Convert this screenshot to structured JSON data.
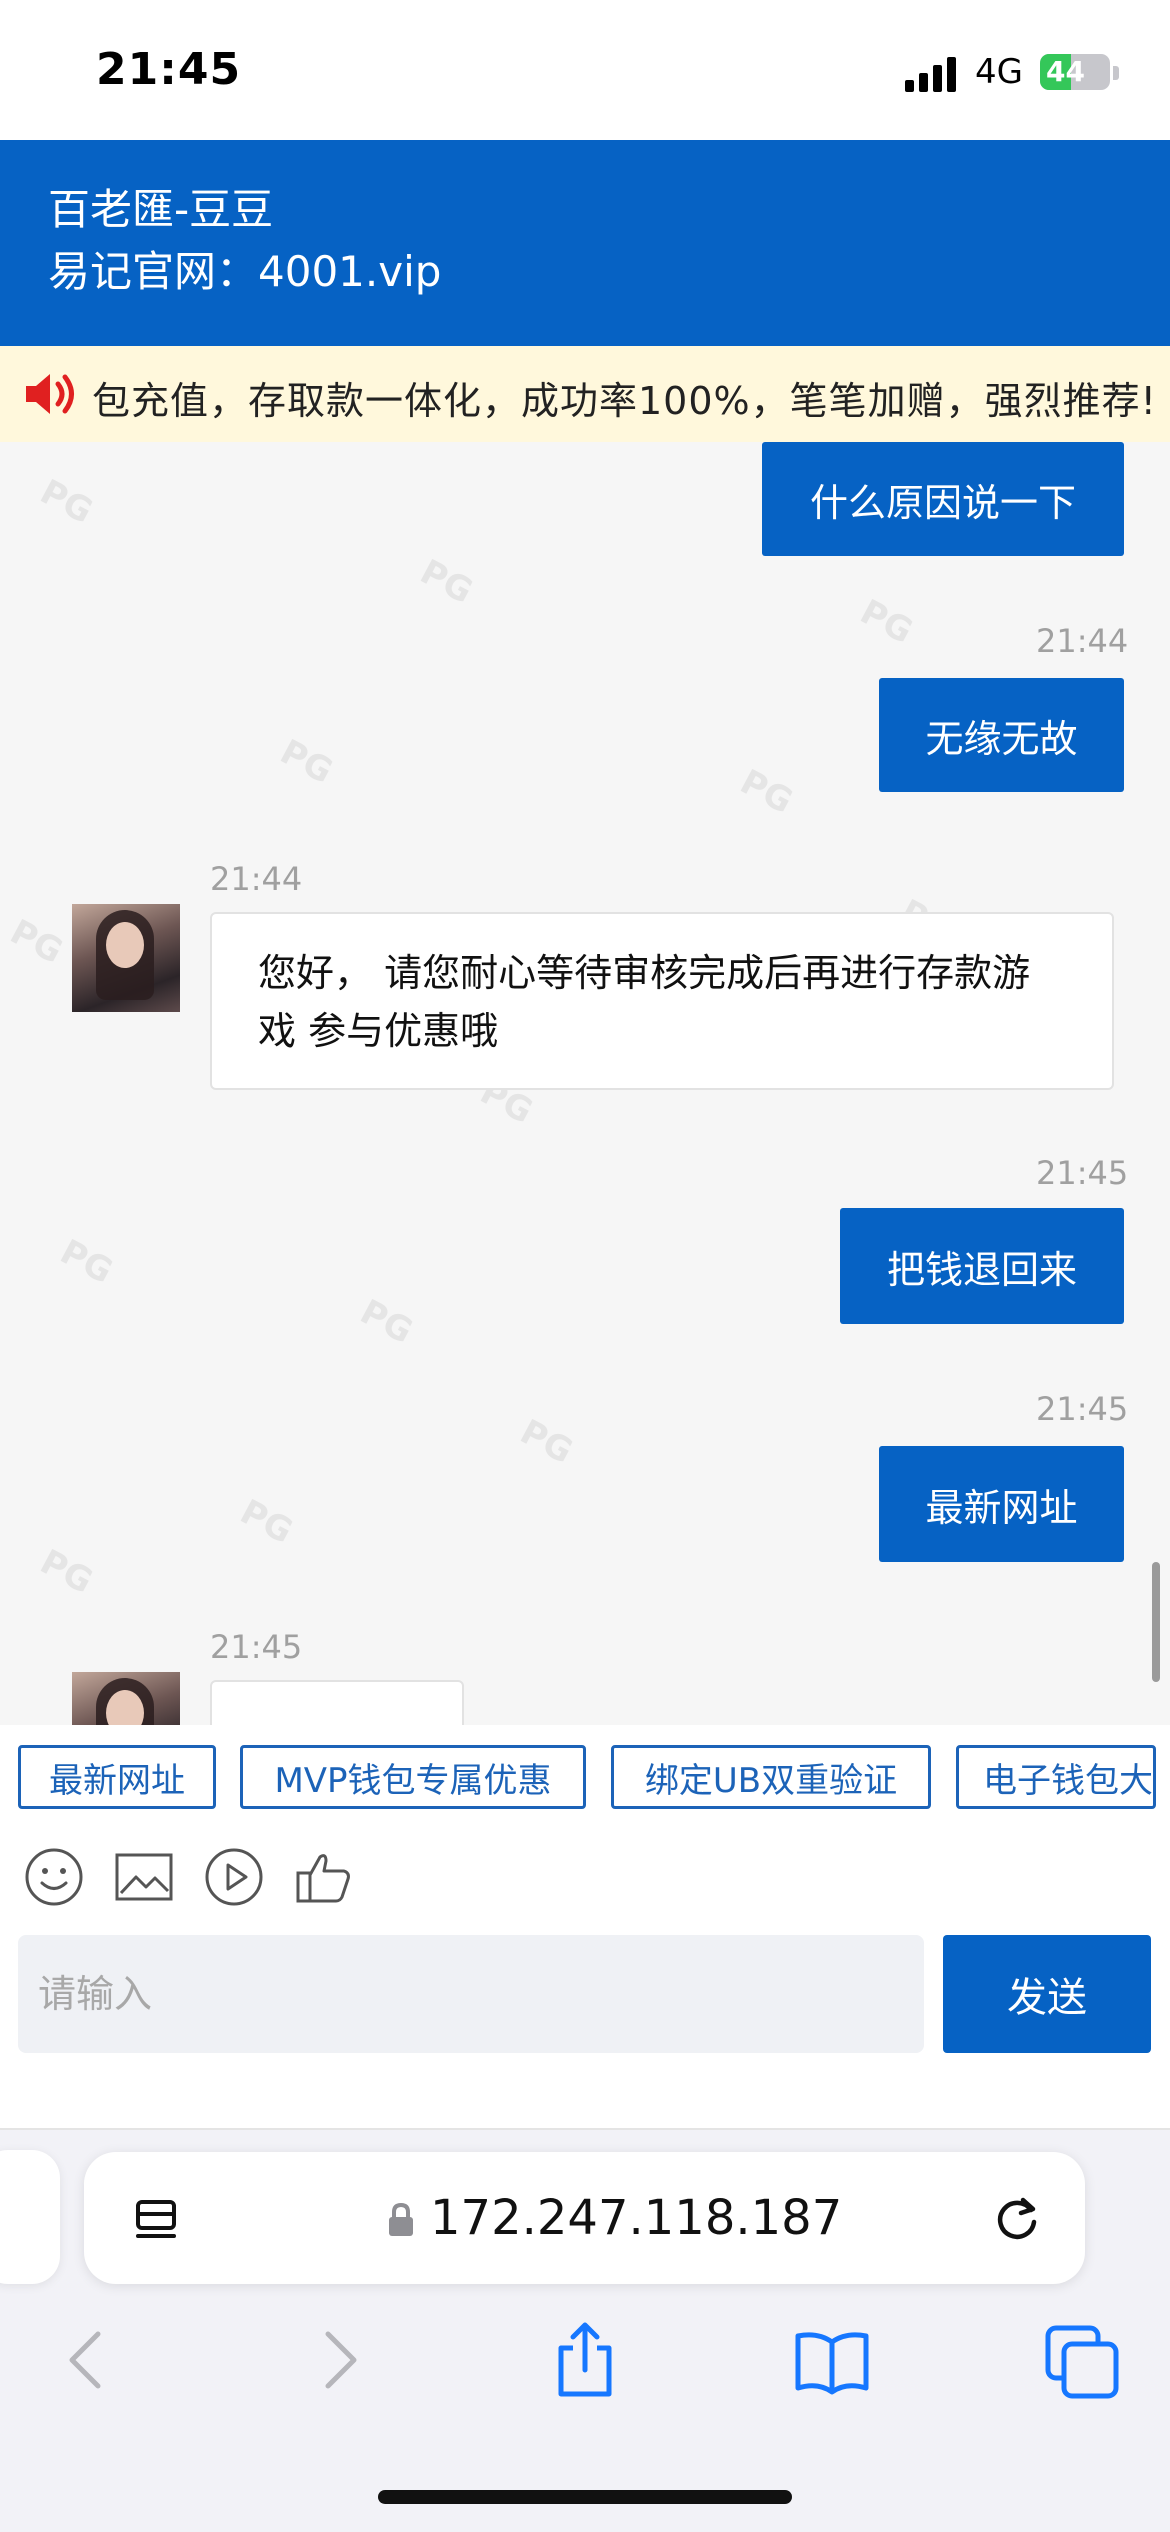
{
  "status_bar": {
    "time": "21:45",
    "network": "4G",
    "battery": "44",
    "battery_level": 0.44
  },
  "header": {
    "title": "百老匯-豆豆",
    "site": "易记官网：4001.vip"
  },
  "notice": {
    "text": "包充值，存取款一体化，成功率100%，笔笔加赠，强烈推荐!"
  },
  "watermark": "PG",
  "messages": [
    {
      "side": "out",
      "text": "什么原因说一下"
    },
    {
      "side": "out",
      "time": "21:44",
      "text": "无缘无故"
    },
    {
      "side": "in",
      "time": "21:44",
      "text": "您好， 请您耐心等待审核完成后再进行存款游戏 参与优惠哦"
    },
    {
      "side": "out",
      "time": "21:45",
      "text": "把钱退回来"
    },
    {
      "side": "out",
      "time": "21:45",
      "text": "最新网址"
    },
    {
      "side": "in",
      "time": "21:45",
      "text": ""
    }
  ],
  "quick_replies": [
    "最新网址",
    "MVP钱包专属优惠",
    "绑定UB双重验证",
    "电子钱包大"
  ],
  "toolbar": {
    "icons": [
      "smiley-icon",
      "image-icon",
      "video-icon",
      "thumbs-up-icon"
    ]
  },
  "input": {
    "placeholder": "请输入",
    "value": ""
  },
  "send_label": "发送",
  "browser": {
    "url": "172.247.118.187"
  }
}
